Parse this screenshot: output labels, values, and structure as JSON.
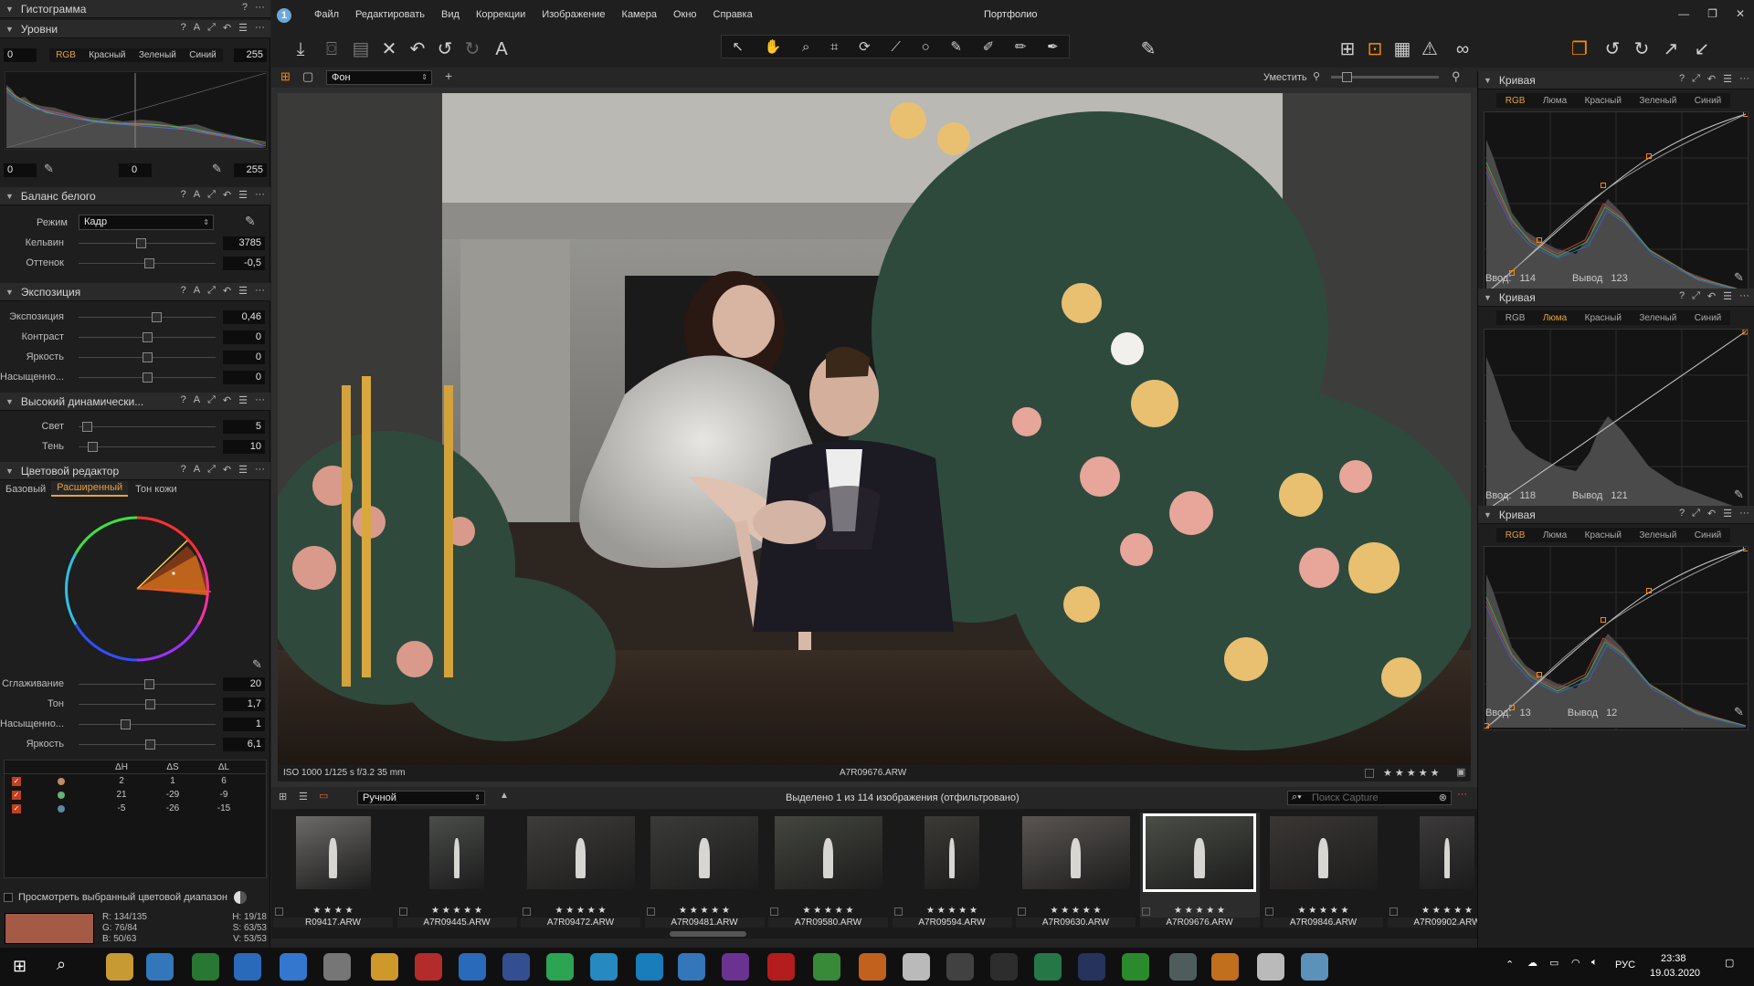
{
  "window": {
    "title": "Портфолио"
  },
  "menu": [
    "Файл",
    "Редактировать",
    "Вид",
    "Коррекции",
    "Изображение",
    "Камера",
    "Окно",
    "Справка"
  ],
  "left": {
    "histogram_title": "Гистограмма",
    "levels": {
      "title": "Уровни",
      "in_left": "0",
      "in_right": "255",
      "channels": [
        "RGB",
        "Красный",
        "Зеленый",
        "Синий"
      ],
      "out_left": "0",
      "out_mid": "0",
      "out_right": "255"
    },
    "wb": {
      "title": "Баланс белого",
      "mode_label": "Режим",
      "mode_value": "Кадр",
      "kelvin_label": "Кельвин",
      "kelvin": "3785",
      "tint_label": "Оттенок",
      "tint": "-0,5"
    },
    "exposure": {
      "title": "Экспозиция",
      "rows": [
        {
          "label": "Экспозиция",
          "value": "0,46"
        },
        {
          "label": "Контраст",
          "value": "0"
        },
        {
          "label": "Яркость",
          "value": "0"
        },
        {
          "label": "Насыщенно...",
          "value": "0"
        }
      ]
    },
    "hdr": {
      "title": "Высокий динамически...",
      "rows": [
        {
          "label": "Свет",
          "value": "5"
        },
        {
          "label": "Тень",
          "value": "10"
        }
      ]
    },
    "color_editor": {
      "title": "Цветовой редактор",
      "tabs": [
        "Базовый",
        "Расширенный",
        "Тон кожи"
      ],
      "rows": [
        {
          "label": "Сглаживание",
          "value": "20"
        },
        {
          "label": "Тон",
          "value": "1,7"
        },
        {
          "label": "Насыщенно...",
          "value": "1"
        },
        {
          "label": "Яркость",
          "value": "6,1"
        }
      ],
      "table_headers": [
        "ΔH",
        "ΔS",
        "ΔL"
      ],
      "table_rows": [
        [
          "2",
          "1",
          "6"
        ],
        [
          "21",
          "-29",
          "-9"
        ],
        [
          "-5",
          "-26",
          "-15"
        ]
      ],
      "table_dot_colors": [
        "#c28a6c",
        "#6ab07a",
        "#5a8aa0"
      ],
      "preview_label": "Просмотреть выбранный цветовой диапазон",
      "rgb": {
        "r": "R: 134/135",
        "g": "G: 76/84",
        "b": "B: 50/63",
        "h": "H: 19/18",
        "s": "S: 63/53",
        "v": "V: 53/53"
      },
      "swatch": "#a55a45"
    }
  },
  "toolbar2": {
    "layer": "Фон",
    "fit_label": "Уместить"
  },
  "viewer": {
    "info": "ISO 1000  1/125 s  f/3.2  35 mm",
    "filename": "A7R09676.ARW",
    "stars": "★ ★ ★ ★ ★"
  },
  "filmbar": {
    "sort": "Ручной",
    "status": "Выделено 1 из 114 изображения (отфильтровано)",
    "search_placeholder": "Поиск Capture"
  },
  "film": [
    {
      "name": "R09417.ARW",
      "stars": "★ ★ ★ ★"
    },
    {
      "name": "A7R09445.ARW",
      "stars": "★ ★ ★ ★ ★"
    },
    {
      "name": "A7R09472.ARW",
      "stars": "★ ★ ★ ★ ★"
    },
    {
      "name": "A7R09481.ARW",
      "stars": "★ ★ ★ ★ ★"
    },
    {
      "name": "A7R09580.ARW",
      "stars": "★ ★ ★ ★ ★"
    },
    {
      "name": "A7R09594.ARW",
      "stars": "★ ★ ★ ★ ★"
    },
    {
      "name": "A7R09630.ARW",
      "stars": "★ ★ ★ ★ ★"
    },
    {
      "name": "A7R09676.ARW",
      "stars": "★ ★ ★ ★ ★"
    },
    {
      "name": "A7R09846.ARW",
      "stars": "★ ★ ★ ★ ★"
    },
    {
      "name": "A7R09902.ARW",
      "stars": "★ ★ ★ ★ ★"
    }
  ],
  "right": {
    "curves": [
      {
        "title": "Кривая",
        "tabs": [
          "RGB",
          "Люма",
          "Красный",
          "Зеленый",
          "Синий"
        ],
        "active": 0,
        "in_label": "Ввод:",
        "in": "114",
        "out_label": "Вывод",
        "out": "123"
      },
      {
        "title": "Кривая",
        "tabs": [
          "RGB",
          "Люма",
          "Красный",
          "Зеленый",
          "Синий"
        ],
        "active": 1,
        "in_label": "Ввод:",
        "in": "118",
        "out_label": "Вывод",
        "out": "121"
      },
      {
        "title": "Кривая",
        "tabs": [
          "RGB",
          "Люма",
          "Красный",
          "Зеленый",
          "Синий"
        ],
        "active": 0,
        "in_label": "Ввод:",
        "in": "13",
        "out_label": "Вывод",
        "out": "12"
      }
    ]
  },
  "taskbar": {
    "lang": "РУС",
    "time": "23:38",
    "date": "19.03.2020"
  },
  "colors": {
    "accent": "#ff8a00",
    "panel": "#1e1e1e",
    "active_tab": "#e8a23a"
  }
}
